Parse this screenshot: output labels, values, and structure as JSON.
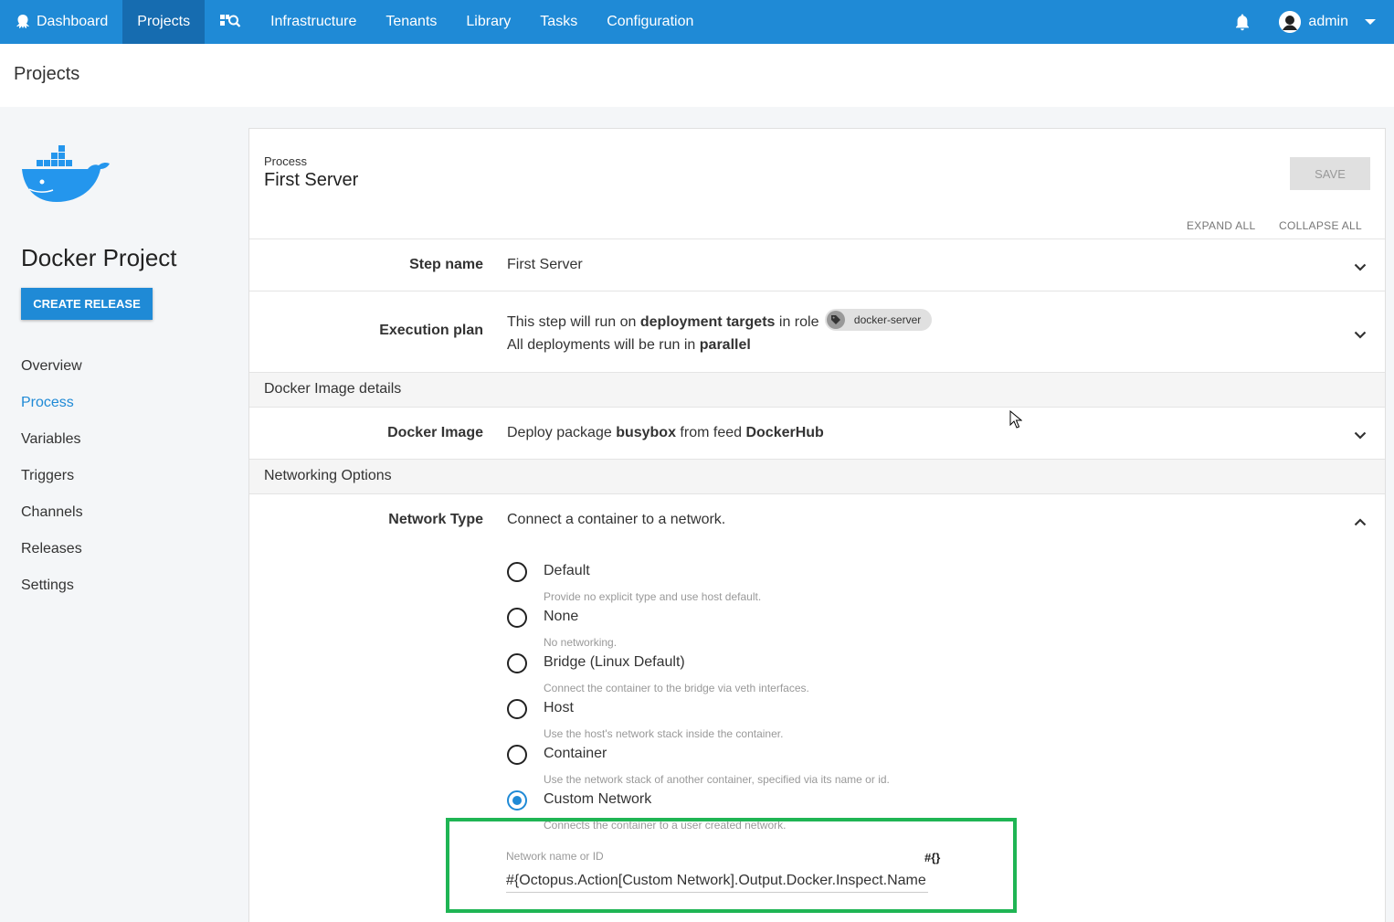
{
  "nav": {
    "items": [
      {
        "label": "Dashboard",
        "icon": "octopus-icon"
      },
      {
        "label": "Projects",
        "active": true
      },
      {
        "label": "",
        "icon": "search-icon"
      },
      {
        "label": "Infrastructure"
      },
      {
        "label": "Tenants"
      },
      {
        "label": "Library"
      },
      {
        "label": "Tasks"
      },
      {
        "label": "Configuration"
      }
    ],
    "user": "admin"
  },
  "page": {
    "title": "Projects"
  },
  "sidebar": {
    "project_name": "Docker Project",
    "create_release": "CREATE RELEASE",
    "items": [
      "Overview",
      "Process",
      "Variables",
      "Triggers",
      "Channels",
      "Releases",
      "Settings"
    ],
    "active_item": "Process"
  },
  "main": {
    "breadcrumb": "Process",
    "title": "First Server",
    "save": "SAVE",
    "expand_all": "EXPAND ALL",
    "collapse_all": "COLLAPSE ALL",
    "step_name": {
      "label": "Step name",
      "value": "First Server"
    },
    "execution_plan": {
      "label": "Execution plan",
      "line1_a": "This step will run on ",
      "line1_b": "deployment targets",
      "line1_c": " in role",
      "role": "docker-server",
      "line2_a": "All deployments will be run in ",
      "line2_b": "parallel"
    },
    "docker_section": "Docker Image details",
    "docker_image": {
      "label": "Docker Image",
      "a": "Deploy package ",
      "package": "busybox",
      "b": " from feed ",
      "feed": "DockerHub"
    },
    "networking_section": "Networking Options",
    "network_type": {
      "label": "Network Type",
      "summary": "Connect a container to a network.",
      "options": [
        {
          "label": "Default",
          "desc": "Provide no explicit type and use host default."
        },
        {
          "label": "None",
          "desc": "No networking."
        },
        {
          "label": "Bridge (Linux Default)",
          "desc": "Connect the container to the bridge via veth interfaces."
        },
        {
          "label": "Host",
          "desc": "Use the host's network stack inside the container."
        },
        {
          "label": "Container",
          "desc": "Use the network stack of another container, specified via its name or id."
        },
        {
          "label": "Custom Network",
          "desc": "Connects the container to a user created network."
        }
      ],
      "selected": "Custom Network"
    },
    "network_name": {
      "label": "Network name or ID",
      "value": "#{Octopus.Action[Custom Network].Output.Docker.Inspect.Name",
      "var_icon": "#{}"
    }
  },
  "colors": {
    "nav": "#1f8ad6",
    "nav_active": "#166cb0",
    "highlight": "#1fb554"
  }
}
